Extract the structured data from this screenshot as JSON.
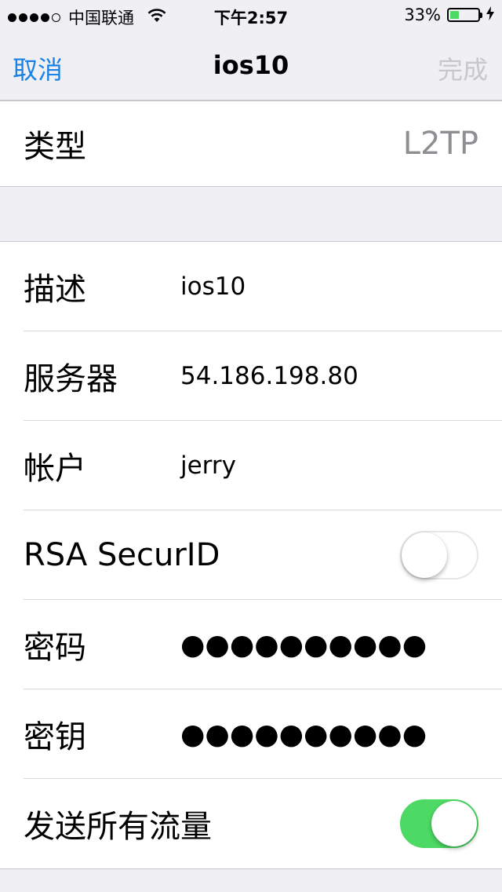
{
  "status_bar": {
    "carrier": "中国联通",
    "time": "下午2:57",
    "battery_percent": "33%",
    "battery_level": 0.33,
    "signal_bars": 4,
    "signal_max": 5,
    "accent_color": "#4cd964"
  },
  "nav": {
    "cancel_label": "取消",
    "title": "ios10",
    "done_label": "完成",
    "accent_color": "#1a82e2"
  },
  "type_row": {
    "label": "类型",
    "value": "L2TP"
  },
  "fields": [
    {
      "label": "描述",
      "value": "ios10"
    },
    {
      "label": "服务器",
      "value": "54.186.198.80"
    },
    {
      "label": "帐户",
      "value": "jerry"
    },
    {
      "label": "RSA SecurID",
      "toggle": false
    },
    {
      "label": "密码",
      "value": "●●●●●●●●●●"
    },
    {
      "label": "密钥",
      "value": "●●●●●●●●●●"
    },
    {
      "label": "发送所有流量",
      "toggle": true
    }
  ]
}
